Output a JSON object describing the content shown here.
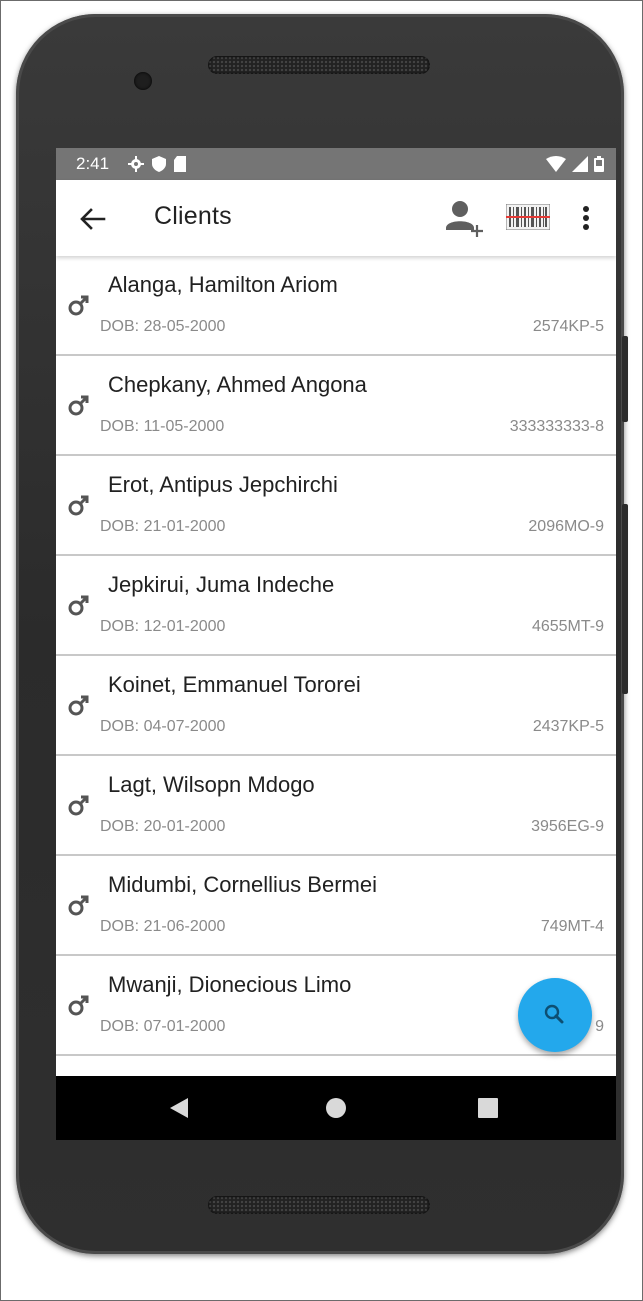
{
  "status_bar": {
    "time": "2:41",
    "left_icons": [
      "settings-icon",
      "shield-icon",
      "sd-card-icon"
    ],
    "right_icons": [
      "wifi-icon",
      "signal-icon",
      "battery-icon"
    ]
  },
  "toolbar": {
    "title": "Clients",
    "actions": [
      "back-arrow-icon",
      "add-person-icon",
      "barcode-icon",
      "more-vert-icon"
    ]
  },
  "clients": [
    {
      "name": "Alanga, Hamilton Ariom",
      "dob": "DOB: 28-05-2000",
      "id": "2574KP-5",
      "gender": "male"
    },
    {
      "name": "Chepkany, Ahmed Angona",
      "dob": "DOB: 11-05-2000",
      "id": "333333333-8",
      "gender": "male"
    },
    {
      "name": "Erot, Antipus Jepchirchi",
      "dob": "DOB: 21-01-2000",
      "id": "2096MO-9",
      "gender": "male"
    },
    {
      "name": "Jepkirui, Juma Indeche",
      "dob": "DOB: 12-01-2000",
      "id": "4655MT-9",
      "gender": "male"
    },
    {
      "name": "Koinet, Emmanuel Tororei",
      "dob": "DOB: 04-07-2000",
      "id": "2437KP-5",
      "gender": "male"
    },
    {
      "name": "Lagt, Wilsopn Mdogo",
      "dob": "DOB: 20-01-2000",
      "id": "3956EG-9",
      "gender": "male"
    },
    {
      "name": "Midumbi, Cornellius Bermei",
      "dob": "DOB: 21-06-2000",
      "id": "749MT-4",
      "gender": "male"
    },
    {
      "name": "Mwanji, Dionecious Limo",
      "dob": "DOB: 07-01-2000",
      "id": "9",
      "gender": "male"
    }
  ],
  "fab": {
    "icon": "search-icon",
    "color": "#23a8ec"
  },
  "colors": {
    "status_bar": "#757575",
    "toolbar": "#ffffff",
    "accent": "#23a8ec",
    "nav_bar": "#000000"
  }
}
